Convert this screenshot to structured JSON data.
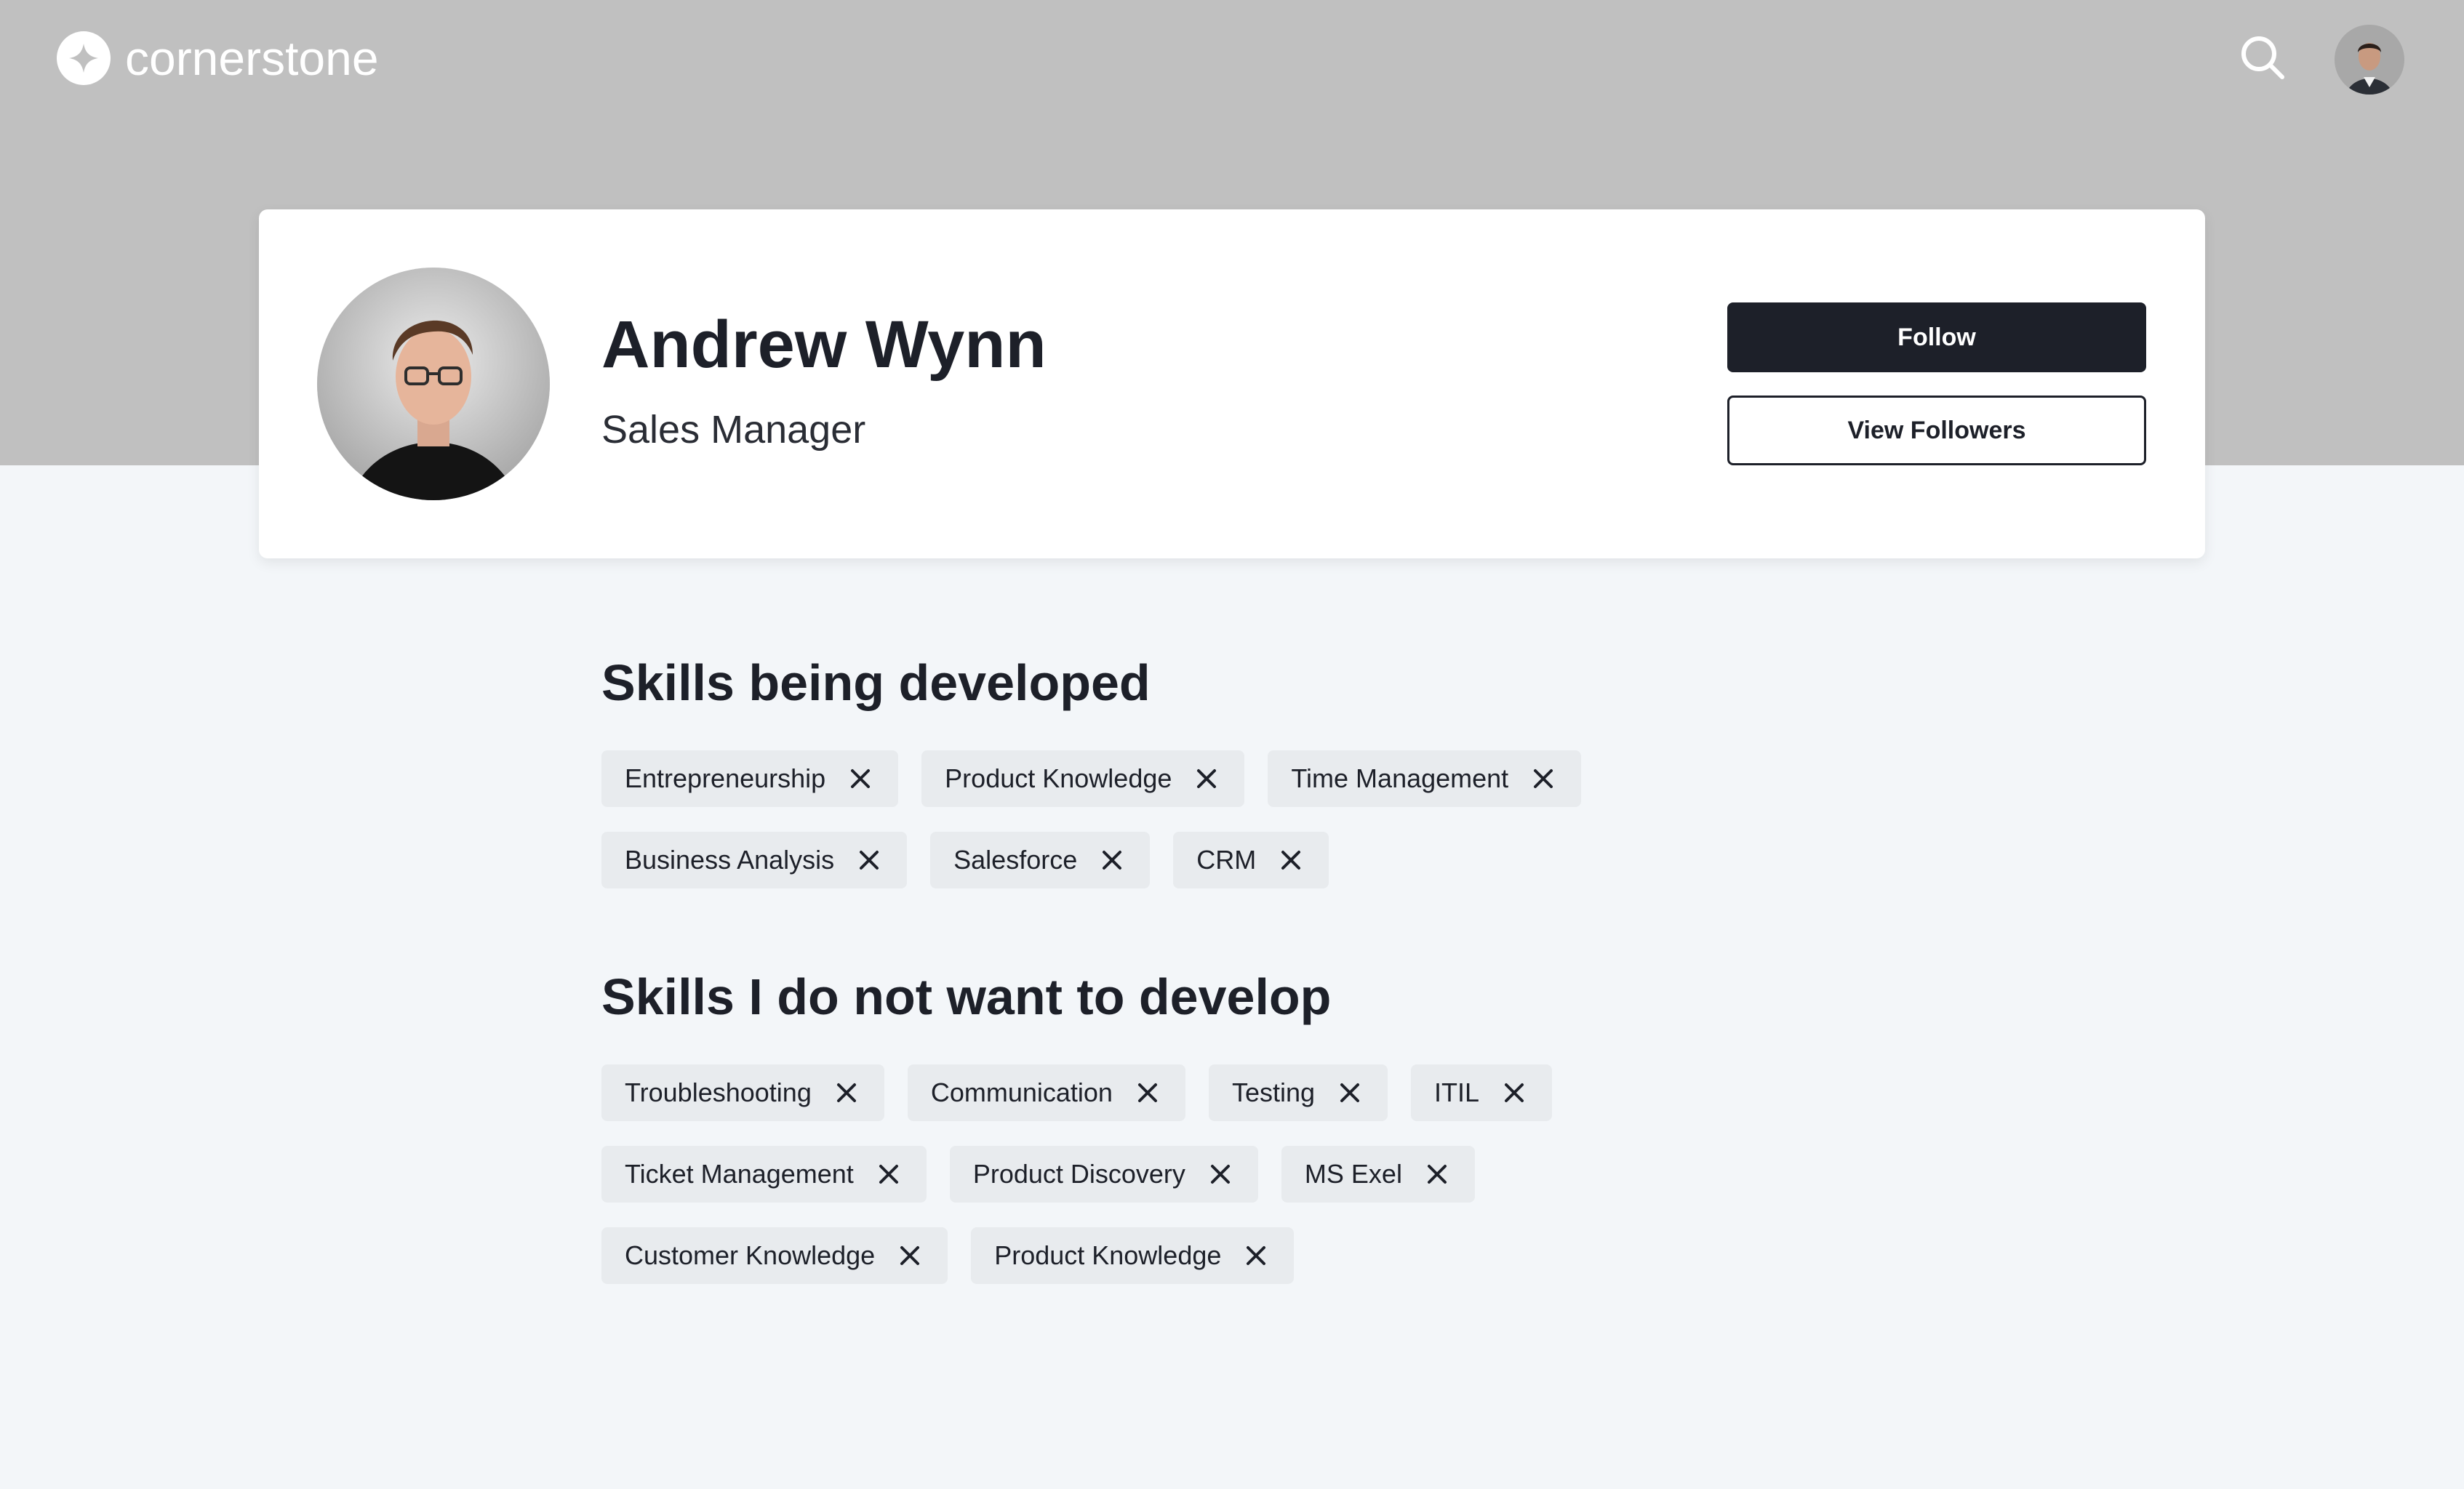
{
  "brand": {
    "name": "cornerstone",
    "logo_icon": "cornerstone-star-icon"
  },
  "header": {
    "search_icon": "search-icon",
    "user_avatar": "user-avatar"
  },
  "profile": {
    "name": "Andrew Wynn",
    "role": "Sales Manager",
    "follow_label": "Follow",
    "view_followers_label": "View Followers"
  },
  "colors": {
    "banner": "#c0c0c0",
    "page_background": "#f3f6f9",
    "primary_button": "#1d2029",
    "chip_background": "#e8ebee"
  },
  "skills_developing": {
    "title": "Skills being developed",
    "rows": [
      [
        "Entrepreneurship",
        "Product Knowledge",
        "Time Management"
      ],
      [
        "Business Analysis",
        "Salesforce",
        "CRM"
      ]
    ]
  },
  "skills_not_developing": {
    "title": "Skills I do not want to develop",
    "rows": [
      [
        "Troubleshooting",
        "Communication",
        "Testing",
        "ITIL"
      ],
      [
        "Ticket Management",
        "Product Discovery",
        "MS Exel"
      ],
      [
        "Customer Knowledge",
        "Product Knowledge"
      ]
    ]
  }
}
